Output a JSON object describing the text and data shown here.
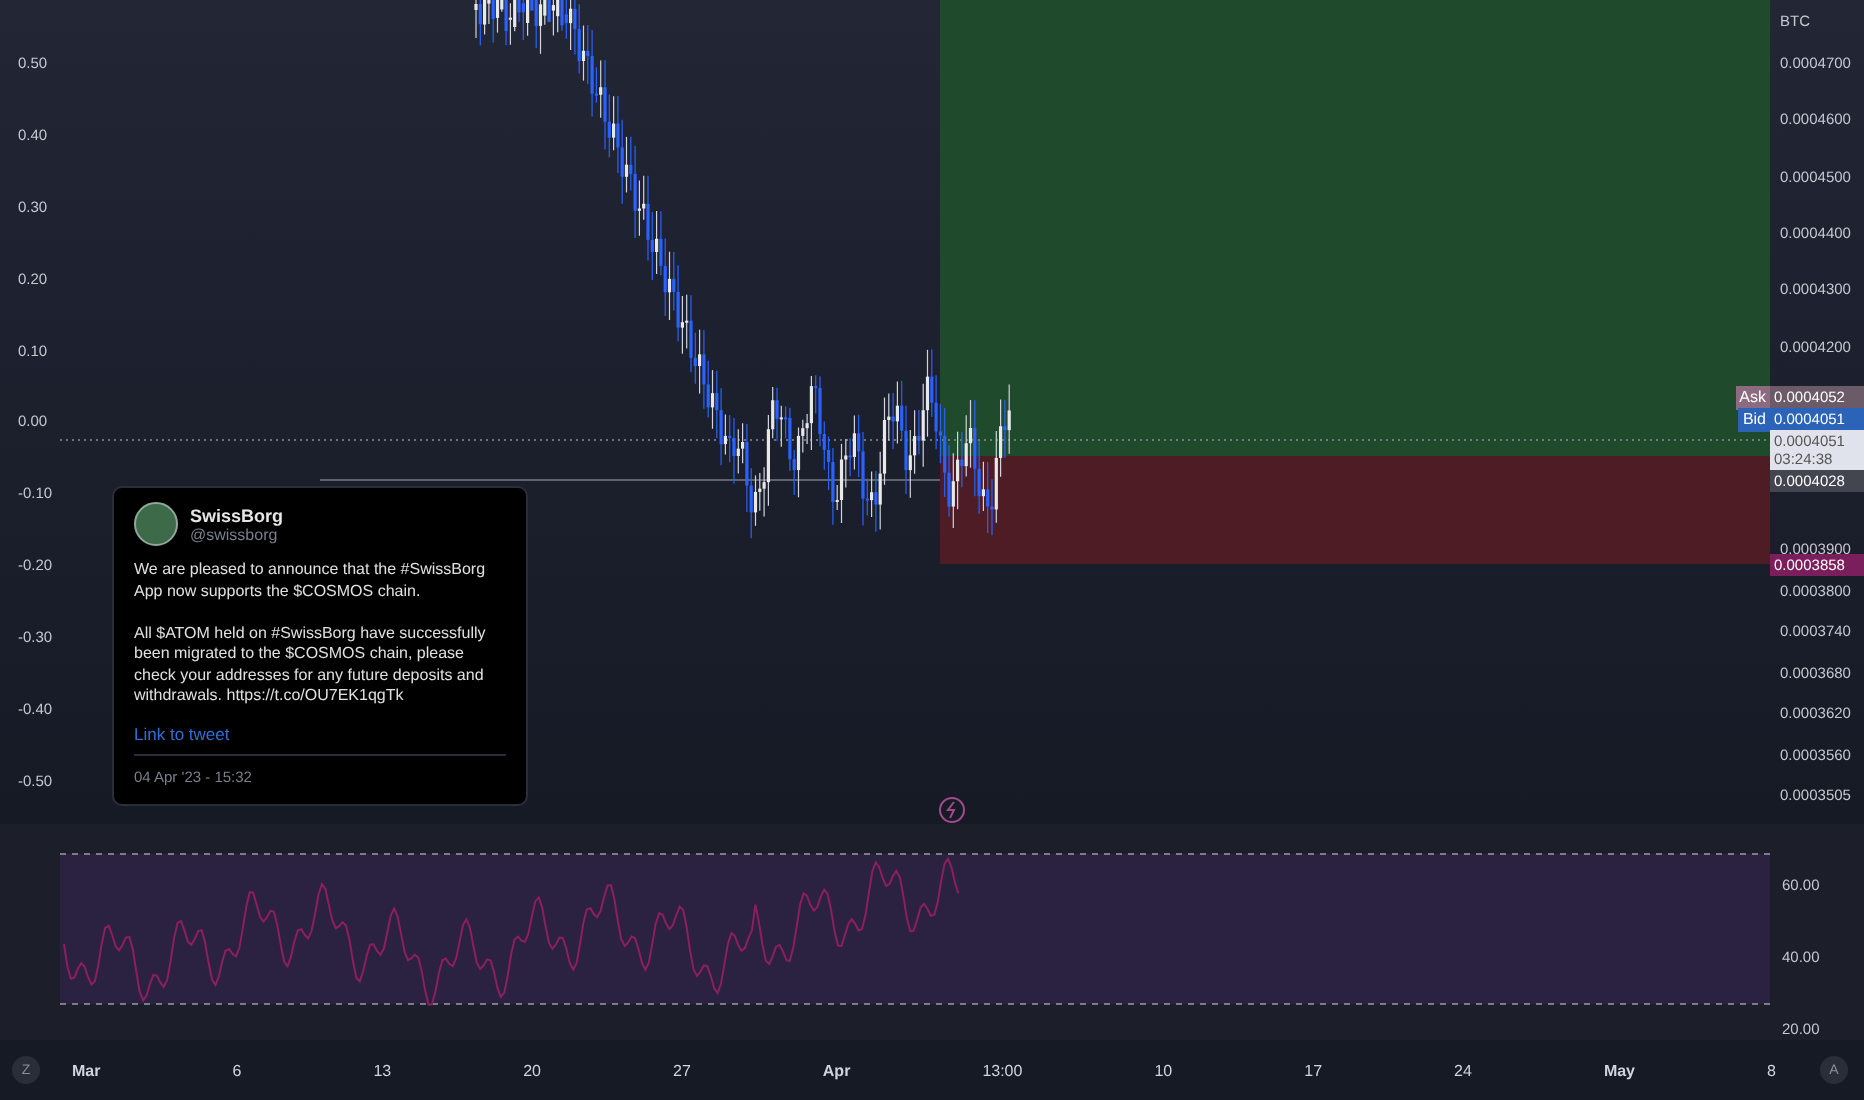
{
  "left_axis": {
    "labels": [
      "0.50",
      "0.40",
      "0.30",
      "0.20",
      "0.10",
      "0.00",
      "-0.10",
      "-0.20",
      "-0.30",
      "-0.40",
      "-0.50"
    ]
  },
  "right_axis": {
    "currency": "BTC",
    "labels": [
      "0.0004700",
      "0.0004600",
      "0.0004500",
      "0.0004400",
      "0.0004300",
      "0.0004200",
      "0.0003900",
      "0.0003800",
      "0.0003740",
      "0.0003680",
      "0.0003620",
      "0.0003560",
      "0.0003505"
    ]
  },
  "price_tags": [
    {
      "kind": "ask",
      "label": "Ask",
      "value": "0.0004052"
    },
    {
      "kind": "bid",
      "label": "Bid",
      "value": "0.0004051"
    },
    {
      "kind": "last",
      "value": "0.0004051",
      "countdown": "03:24:38"
    },
    {
      "kind": "level",
      "value": "0.0004028"
    },
    {
      "kind": "stop",
      "value": "0.0003858"
    }
  ],
  "tweet": {
    "author": "SwissBorg",
    "handle": "@swissborg",
    "text": "We are pleased to announce that the #SwissBorg App now supports the $COSMOS chain.\n\nAll $ATOM held on #SwissBorg have successfully been migrated to the $COSMOS chain, please check your addresses for any future deposits and withdrawals. https://t.co/OU7EK1qgTk",
    "link": "Link to tweet",
    "date": "04 Apr '23 - 15:32"
  },
  "rsi": {
    "labels": [
      "60.00",
      "40.00",
      "20.00"
    ]
  },
  "time_axis": {
    "left_button": "Z",
    "right_button": "A",
    "labels": [
      {
        "text": "Mar",
        "kind": "month"
      },
      {
        "text": "6",
        "kind": "day"
      },
      {
        "text": "13",
        "kind": "day"
      },
      {
        "text": "20",
        "kind": "day"
      },
      {
        "text": "27",
        "kind": "day"
      },
      {
        "text": "Apr",
        "kind": "month"
      },
      {
        "text": "13:00",
        "kind": "time"
      },
      {
        "text": "10",
        "kind": "day"
      },
      {
        "text": "17",
        "kind": "day"
      },
      {
        "text": "24",
        "kind": "day"
      },
      {
        "text": "May",
        "kind": "month"
      },
      {
        "text": "8",
        "kind": "day"
      }
    ]
  }
}
